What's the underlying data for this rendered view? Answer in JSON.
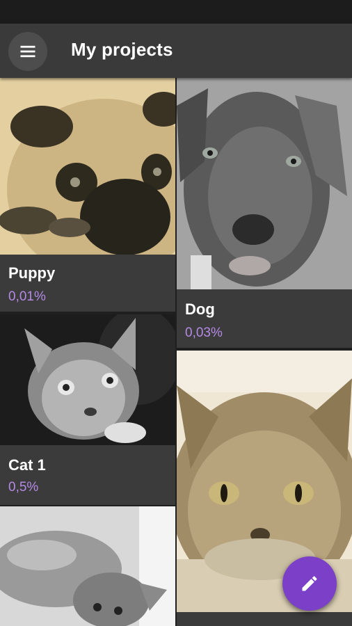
{
  "appbar": {
    "title": "My projects",
    "menu_icon": "menu-icon"
  },
  "projects": [
    {
      "name": "Puppy",
      "progress": "0,01%"
    },
    {
      "name": "Dog",
      "progress": "0,03%"
    },
    {
      "name": "Cat 1",
      "progress": "0,5%"
    },
    {
      "name": "",
      "progress": ""
    },
    {
      "name": "",
      "progress": ""
    }
  ],
  "fab": {
    "icon": "pencil-icon"
  },
  "colors": {
    "accent": "#7b3fc8",
    "progress_text": "#b48ae6",
    "card_bg": "#3b3b3b",
    "appbar_bg": "#3a3a3a"
  }
}
